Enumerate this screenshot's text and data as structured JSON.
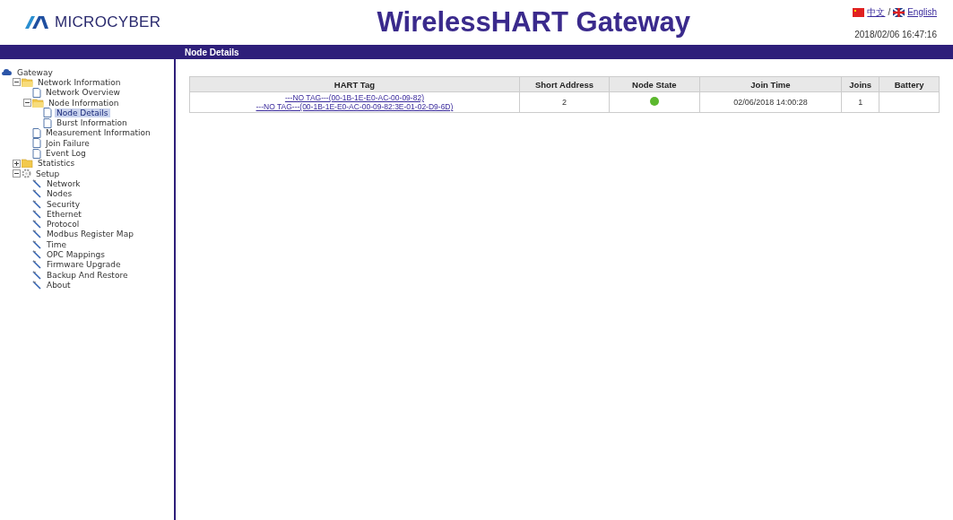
{
  "header": {
    "logo": "MICROCYBER",
    "title": "WirelessHART Gateway",
    "languages": [
      {
        "label": "中文",
        "kind": "china"
      },
      {
        "label": "English",
        "kind": "britain"
      }
    ],
    "separator": "/",
    "datetime": "2018/02/06 16:47:16"
  },
  "page_title": "Node Details",
  "tree": [
    {
      "label": "Gateway",
      "kind": "root",
      "children": [
        {
          "label": "Network Information",
          "kind": "folder",
          "expanded": true,
          "children": [
            {
              "label": "Network Overview",
              "kind": "page",
              "selected": false
            },
            {
              "label": "Node Information",
              "kind": "folder",
              "expanded": true,
              "children": [
                {
                  "label": "Node Details",
                  "kind": "page",
                  "selected": true
                },
                {
                  "label": "Burst Information",
                  "kind": "page",
                  "selected": false
                }
              ]
            },
            {
              "label": "Measurement Information",
              "kind": "page",
              "selected": false
            },
            {
              "label": "Join Failure",
              "kind": "page",
              "selected": false
            },
            {
              "label": "Event Log",
              "kind": "page",
              "selected": false
            }
          ]
        },
        {
          "label": "Statistics",
          "kind": "folder",
          "expanded": false
        },
        {
          "label": "Setup",
          "kind": "gear",
          "expanded": true,
          "children": [
            {
              "label": "Network",
              "kind": "tool",
              "selected": false
            },
            {
              "label": "Nodes",
              "kind": "tool",
              "selected": false
            },
            {
              "label": "Security",
              "kind": "tool",
              "selected": false
            },
            {
              "label": "Ethernet",
              "kind": "tool",
              "selected": false
            },
            {
              "label": "Protocol",
              "kind": "tool",
              "selected": false
            },
            {
              "label": "Modbus Register Map",
              "kind": "tool",
              "selected": false
            },
            {
              "label": "Time",
              "kind": "tool",
              "selected": false
            },
            {
              "label": "OPC Mappings",
              "kind": "tool",
              "selected": false
            },
            {
              "label": "Firmware Upgrade",
              "kind": "tool",
              "selected": false
            },
            {
              "label": "Backup And Restore",
              "kind": "tool",
              "selected": false
            },
            {
              "label": "About",
              "kind": "tool",
              "selected": false
            }
          ]
        }
      ]
    }
  ],
  "table": {
    "columns": [
      "HART Tag",
      "Short Address",
      "Node State",
      "Join Time",
      "Joins",
      "Battery"
    ],
    "rows": [
      {
        "hart_tag": [
          "---NO TAG---(00-1B-1E-E0-AC-00-09-82)",
          "---NO TAG---(00-1B-1E-E0-AC-00-09-82:3E-01-02-D9-6D)"
        ],
        "short_address": "2",
        "node_state": {
          "color": "#5cb82e"
        },
        "join_time": "02/06/2018 14:00:28",
        "joins": "1"
      }
    ]
  }
}
